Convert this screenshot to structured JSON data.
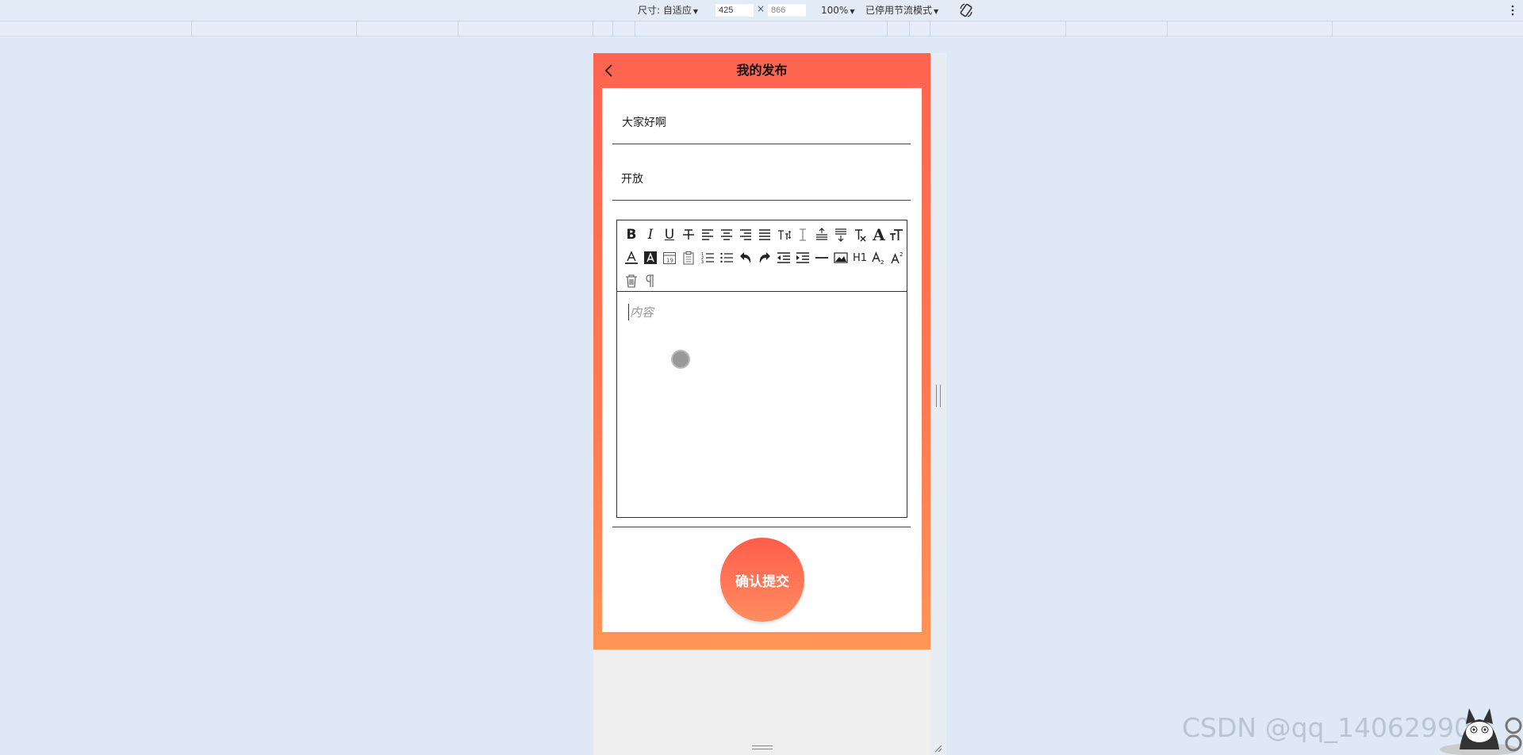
{
  "devtools": {
    "size_label": "尺寸: 自适应",
    "width_value": "425",
    "times": "×",
    "height_value": "866",
    "zoom": "100%",
    "throttle": "已停用节流模式",
    "icons": [
      "chevron-down-icon",
      "rotate-icon",
      "more-vert-icon"
    ]
  },
  "app": {
    "title": "我的发布",
    "back_icon": "chevron-left-icon",
    "fields": [
      {
        "value": "大家好啊"
      },
      {
        "value": "开放"
      }
    ],
    "editor": {
      "placeholder": "内容",
      "toolbar_row1": [
        "B",
        "I",
        "U",
        "S",
        "align-left",
        "align-center",
        "align-right",
        "align-justify",
        "TI",
        "line-height",
        "paragraph-spacing",
        "indent-top",
        "Ix",
        "A",
        "TT"
      ],
      "toolbar_row2": [
        "font-color",
        "background-color",
        "date",
        "clipboard",
        "ordered-list",
        "unordered-list",
        "undo",
        "redo",
        "outdent",
        "indent",
        "horizontal-rule",
        "image",
        "H1",
        "subscript",
        "superscript"
      ],
      "toolbar_row3": [
        "trash",
        "pilcrow"
      ],
      "h1_label": "H1"
    },
    "submit_label": "确认提交"
  },
  "colors": {
    "header_top": "#fe6450",
    "header_bottom": "#ff9557",
    "background": "#dfe8f5"
  },
  "watermark": "CSDN @qq_14062990"
}
